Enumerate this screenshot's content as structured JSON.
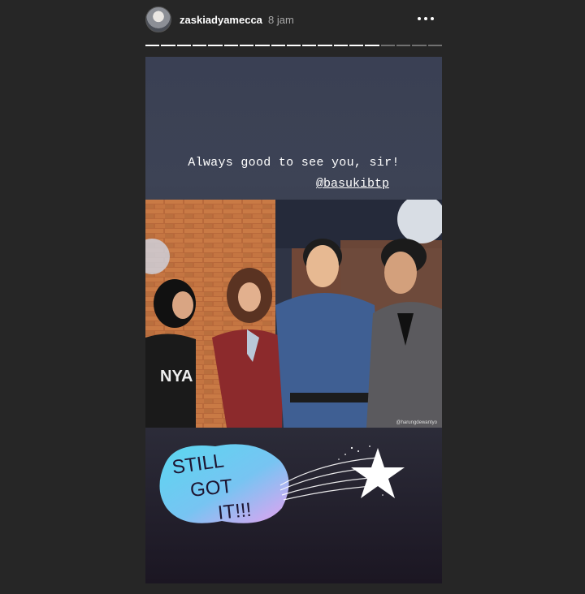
{
  "header": {
    "username": "zaskiadyamecca",
    "time": "8 jam"
  },
  "progress": {
    "total": 19,
    "completed": 15
  },
  "story": {
    "caption": "Always good to see you, sir!",
    "mention": "@basukibtp",
    "photo_credit": "@harungdewantyo",
    "sticker": {
      "line1": "STILL",
      "line2": "GOT",
      "line3": "IT!!!"
    }
  },
  "colors": {
    "background": "#262626",
    "username": "#ffffff",
    "time": "#a8a8a8"
  }
}
